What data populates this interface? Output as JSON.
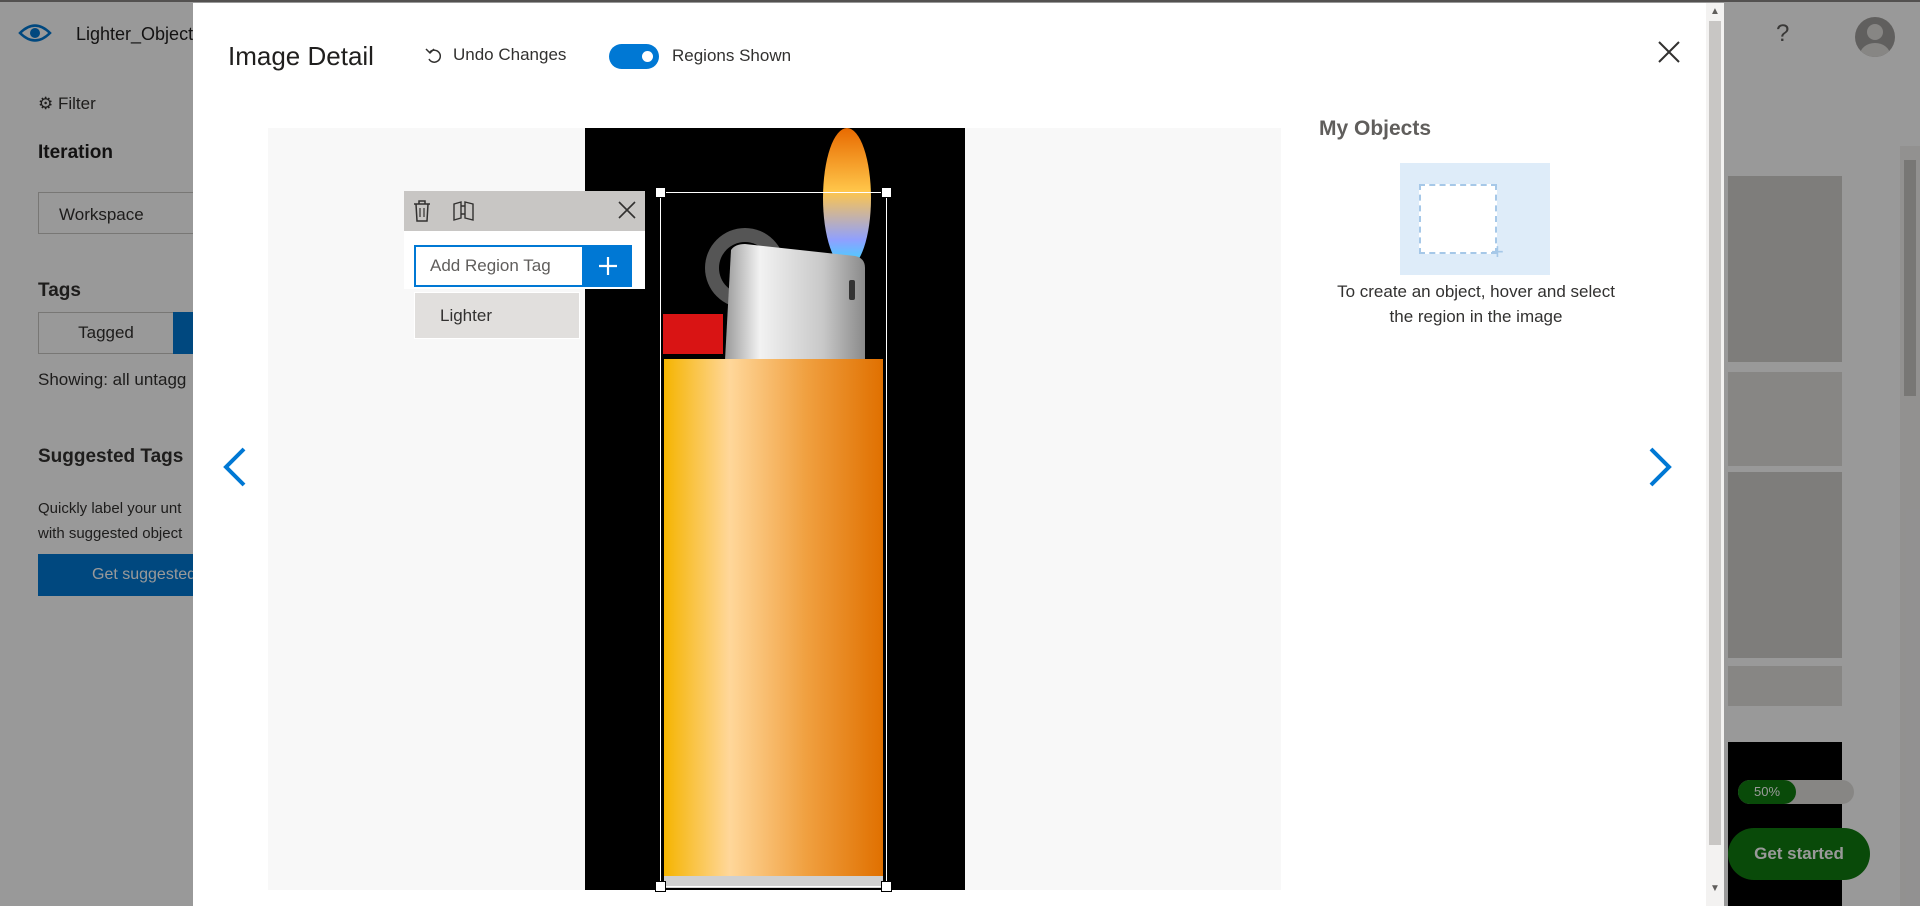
{
  "app": {
    "project_name": "Lighter_Object",
    "help_icon": "?",
    "sidebar": {
      "filter_label": "Filter",
      "iteration_title": "Iteration",
      "iteration_value": "Workspace",
      "tags_title": "Tags",
      "tagged_label": "Tagged",
      "showing_text": "Showing: all untagg",
      "suggested_title": "Suggested Tags",
      "suggested_desc_line1": "Quickly label your unt",
      "suggested_desc_line2": "with suggested object",
      "suggest_button": "Get suggested"
    },
    "progress_label": "50%",
    "progress_value": 0.5,
    "get_started_label": "Get started"
  },
  "modal": {
    "title": "Image Detail",
    "undo_label": "Undo Changes",
    "regions_toggle_label": "Regions Shown",
    "regions_toggle_on": true,
    "region_tag_input": {
      "value": "",
      "placeholder": "Add Region Tag"
    },
    "tag_suggestion": "Lighter",
    "my_objects": {
      "title": "My Objects",
      "hint_line1": "To create an object, hover and select",
      "hint_line2": "the region in the image"
    }
  },
  "colors": {
    "accent": "#0078d4",
    "success": "#107c10",
    "object_card": "#deecf9"
  },
  "icons": [
    "eye-icon",
    "filter-icon",
    "help-icon",
    "undo-icon",
    "close-icon",
    "trash-icon",
    "split-icon",
    "plus-icon",
    "chevron-left-icon",
    "chevron-right-icon"
  ]
}
